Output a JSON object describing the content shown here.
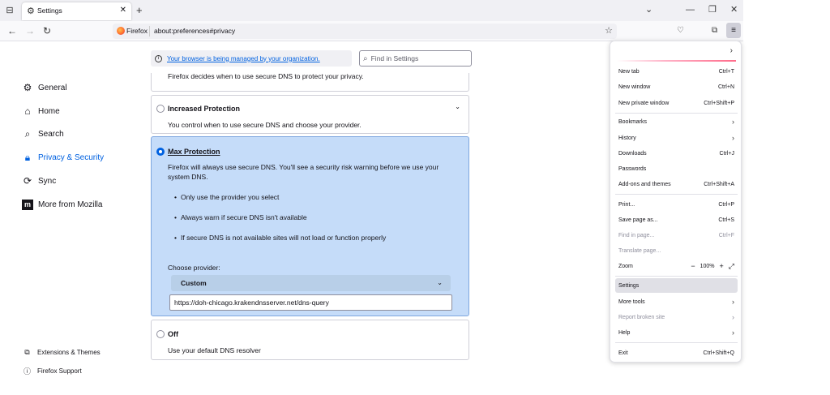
{
  "tab": {
    "title": "Settings"
  },
  "urlbar": {
    "identity": "Firefox",
    "url": "about:preferences#privacy"
  },
  "sidebar": {
    "items": [
      {
        "label": "General"
      },
      {
        "label": "Home"
      },
      {
        "label": "Search"
      },
      {
        "label": "Privacy & Security"
      },
      {
        "label": "Sync"
      },
      {
        "label": "More from Mozilla"
      }
    ],
    "footer": [
      {
        "label": "Extensions & Themes"
      },
      {
        "label": "Firefox Support"
      }
    ]
  },
  "managed_notice": "Your browser is being managed by your organization.",
  "search": {
    "placeholder": "Find in Settings"
  },
  "dns": {
    "partial_text": "Firefox decides when to use secure DNS to protect your privacy.",
    "increased": {
      "title": "Increased Protection",
      "desc": "You control when to use secure DNS and choose your provider."
    },
    "max": {
      "title": "Max Protection",
      "desc": "Firefox will always use secure DNS. You'll see a security risk warning before we use your system DNS.",
      "bullets": [
        "Only use the provider you select",
        "Always warn if secure DNS isn't available",
        "If secure DNS is not available sites will not load or function properly"
      ],
      "provider_label": "Choose provider:",
      "provider_value": "Custom",
      "custom_url": "https://doh-chicago.krakendnsserver.net/dns-query"
    },
    "off": {
      "title": "Off",
      "desc": "Use your default DNS resolver"
    }
  },
  "app_menu": {
    "items": [
      {
        "label": "New tab",
        "shortcut": "Ctrl+T"
      },
      {
        "label": "New window",
        "shortcut": "Ctrl+N"
      },
      {
        "label": "New private window",
        "shortcut": "Ctrl+Shift+P"
      },
      {
        "label": "Bookmarks",
        "shortcut": ""
      },
      {
        "label": "History",
        "shortcut": ""
      },
      {
        "label": "Downloads",
        "shortcut": "Ctrl+J"
      },
      {
        "label": "Passwords",
        "shortcut": ""
      },
      {
        "label": "Add-ons and themes",
        "shortcut": "Ctrl+Shift+A"
      },
      {
        "label": "Print...",
        "shortcut": "Ctrl+P"
      },
      {
        "label": "Save page as...",
        "shortcut": "Ctrl+S"
      },
      {
        "label": "Find in page...",
        "shortcut": "Ctrl+F"
      },
      {
        "label": "Translate page...",
        "shortcut": ""
      },
      {
        "label": "Zoom",
        "shortcut": ""
      },
      {
        "label": "Settings",
        "shortcut": ""
      },
      {
        "label": "More tools",
        "shortcut": ""
      },
      {
        "label": "Report broken site",
        "shortcut": ""
      },
      {
        "label": "Help",
        "shortcut": ""
      },
      {
        "label": "Exit",
        "shortcut": "Ctrl+Shift+Q"
      }
    ],
    "zoom": {
      "minus": "−",
      "level": "100%",
      "plus": "+"
    }
  }
}
